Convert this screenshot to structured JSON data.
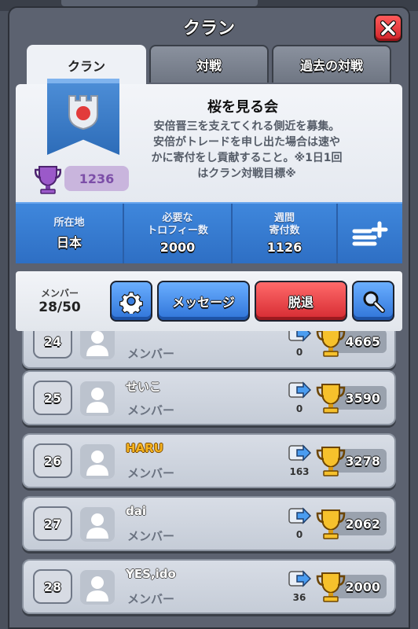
{
  "window": {
    "title": "クラン",
    "close_icon": "close-icon"
  },
  "tabs": [
    {
      "label": "クラン",
      "active": true
    },
    {
      "label": "対戦",
      "active": false
    },
    {
      "label": "過去の対戦",
      "active": false
    }
  ],
  "clan": {
    "name": "桜を見る会",
    "description_lines": [
      "安倍晋三を支えてくれる側近を募集。",
      "安倍がトレードを申し出た場合は速や",
      "かに寄付をし貢献すること。※1日1回",
      "はクラン対戦目標※"
    ],
    "trophies": "1236",
    "banner_color": "#3d7fd0",
    "trophy_color": "#7c4ea8"
  },
  "stats": [
    {
      "label": "所在地",
      "value": "日本"
    },
    {
      "label": "必要な\nトロフィー数",
      "value": "2000"
    },
    {
      "label": "週間\n寄付数",
      "value": "1126"
    }
  ],
  "actions": {
    "members_label": "メンバー",
    "members_value": "28/50",
    "settings_icon": "gear-icon",
    "message_label": "メッセージ",
    "leave_label": "脱退",
    "search_icon": "search-icon",
    "menu_icon": "list-add-icon"
  },
  "members": [
    {
      "rank": "24",
      "name": "",
      "role": "メンバー",
      "donations": "0",
      "trophies": "4665",
      "name_gold": false,
      "partial": true
    },
    {
      "rank": "25",
      "name": "せいこ",
      "role": "メンバー",
      "donations": "0",
      "trophies": "3590",
      "name_gold": false
    },
    {
      "rank": "26",
      "name": "HARU",
      "role": "メンバー",
      "donations": "163",
      "trophies": "3278",
      "name_gold": true
    },
    {
      "rank": "27",
      "name": "dai",
      "role": "メンバー",
      "donations": "0",
      "trophies": "2062",
      "name_gold": false
    },
    {
      "rank": "28",
      "name": "YES,ido",
      "role": "メンバー",
      "donations": "36",
      "trophies": "2000",
      "name_gold": false
    }
  ]
}
